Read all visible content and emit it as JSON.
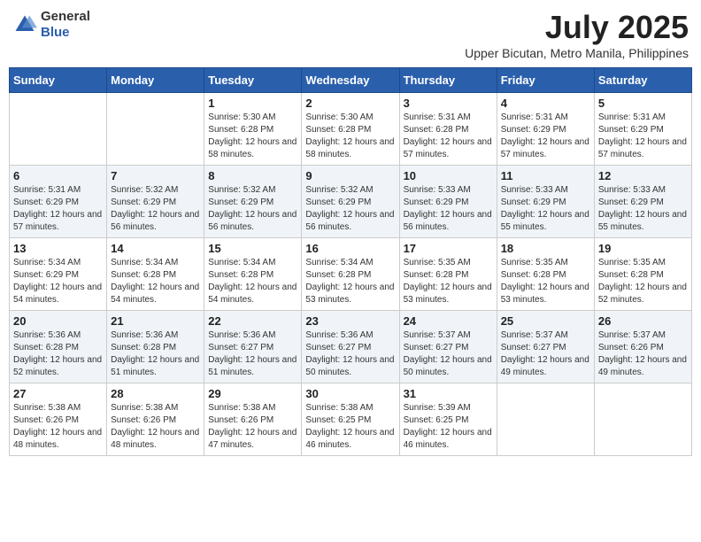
{
  "logo": {
    "general": "General",
    "blue": "Blue"
  },
  "title": "July 2025",
  "subtitle": "Upper Bicutan, Metro Manila, Philippines",
  "weekdays": [
    "Sunday",
    "Monday",
    "Tuesday",
    "Wednesday",
    "Thursday",
    "Friday",
    "Saturday"
  ],
  "weeks": [
    [
      {
        "day": "",
        "info": ""
      },
      {
        "day": "",
        "info": ""
      },
      {
        "day": "1",
        "sunrise": "5:30 AM",
        "sunset": "6:28 PM",
        "daylight": "12 hours and 58 minutes."
      },
      {
        "day": "2",
        "sunrise": "5:30 AM",
        "sunset": "6:28 PM",
        "daylight": "12 hours and 58 minutes."
      },
      {
        "day": "3",
        "sunrise": "5:31 AM",
        "sunset": "6:28 PM",
        "daylight": "12 hours and 57 minutes."
      },
      {
        "day": "4",
        "sunrise": "5:31 AM",
        "sunset": "6:29 PM",
        "daylight": "12 hours and 57 minutes."
      },
      {
        "day": "5",
        "sunrise": "5:31 AM",
        "sunset": "6:29 PM",
        "daylight": "12 hours and 57 minutes."
      }
    ],
    [
      {
        "day": "6",
        "sunrise": "5:31 AM",
        "sunset": "6:29 PM",
        "daylight": "12 hours and 57 minutes."
      },
      {
        "day": "7",
        "sunrise": "5:32 AM",
        "sunset": "6:29 PM",
        "daylight": "12 hours and 56 minutes."
      },
      {
        "day": "8",
        "sunrise": "5:32 AM",
        "sunset": "6:29 PM",
        "daylight": "12 hours and 56 minutes."
      },
      {
        "day": "9",
        "sunrise": "5:32 AM",
        "sunset": "6:29 PM",
        "daylight": "12 hours and 56 minutes."
      },
      {
        "day": "10",
        "sunrise": "5:33 AM",
        "sunset": "6:29 PM",
        "daylight": "12 hours and 56 minutes."
      },
      {
        "day": "11",
        "sunrise": "5:33 AM",
        "sunset": "6:29 PM",
        "daylight": "12 hours and 55 minutes."
      },
      {
        "day": "12",
        "sunrise": "5:33 AM",
        "sunset": "6:29 PM",
        "daylight": "12 hours and 55 minutes."
      }
    ],
    [
      {
        "day": "13",
        "sunrise": "5:34 AM",
        "sunset": "6:29 PM",
        "daylight": "12 hours and 54 minutes."
      },
      {
        "day": "14",
        "sunrise": "5:34 AM",
        "sunset": "6:28 PM",
        "daylight": "12 hours and 54 minutes."
      },
      {
        "day": "15",
        "sunrise": "5:34 AM",
        "sunset": "6:28 PM",
        "daylight": "12 hours and 54 minutes."
      },
      {
        "day": "16",
        "sunrise": "5:34 AM",
        "sunset": "6:28 PM",
        "daylight": "12 hours and 53 minutes."
      },
      {
        "day": "17",
        "sunrise": "5:35 AM",
        "sunset": "6:28 PM",
        "daylight": "12 hours and 53 minutes."
      },
      {
        "day": "18",
        "sunrise": "5:35 AM",
        "sunset": "6:28 PM",
        "daylight": "12 hours and 53 minutes."
      },
      {
        "day": "19",
        "sunrise": "5:35 AM",
        "sunset": "6:28 PM",
        "daylight": "12 hours and 52 minutes."
      }
    ],
    [
      {
        "day": "20",
        "sunrise": "5:36 AM",
        "sunset": "6:28 PM",
        "daylight": "12 hours and 52 minutes."
      },
      {
        "day": "21",
        "sunrise": "5:36 AM",
        "sunset": "6:28 PM",
        "daylight": "12 hours and 51 minutes."
      },
      {
        "day": "22",
        "sunrise": "5:36 AM",
        "sunset": "6:27 PM",
        "daylight": "12 hours and 51 minutes."
      },
      {
        "day": "23",
        "sunrise": "5:36 AM",
        "sunset": "6:27 PM",
        "daylight": "12 hours and 50 minutes."
      },
      {
        "day": "24",
        "sunrise": "5:37 AM",
        "sunset": "6:27 PM",
        "daylight": "12 hours and 50 minutes."
      },
      {
        "day": "25",
        "sunrise": "5:37 AM",
        "sunset": "6:27 PM",
        "daylight": "12 hours and 49 minutes."
      },
      {
        "day": "26",
        "sunrise": "5:37 AM",
        "sunset": "6:26 PM",
        "daylight": "12 hours and 49 minutes."
      }
    ],
    [
      {
        "day": "27",
        "sunrise": "5:38 AM",
        "sunset": "6:26 PM",
        "daylight": "12 hours and 48 minutes."
      },
      {
        "day": "28",
        "sunrise": "5:38 AM",
        "sunset": "6:26 PM",
        "daylight": "12 hours and 48 minutes."
      },
      {
        "day": "29",
        "sunrise": "5:38 AM",
        "sunset": "6:26 PM",
        "daylight": "12 hours and 47 minutes."
      },
      {
        "day": "30",
        "sunrise": "5:38 AM",
        "sunset": "6:25 PM",
        "daylight": "12 hours and 46 minutes."
      },
      {
        "day": "31",
        "sunrise": "5:39 AM",
        "sunset": "6:25 PM",
        "daylight": "12 hours and 46 minutes."
      },
      {
        "day": "",
        "info": ""
      },
      {
        "day": "",
        "info": ""
      }
    ]
  ]
}
